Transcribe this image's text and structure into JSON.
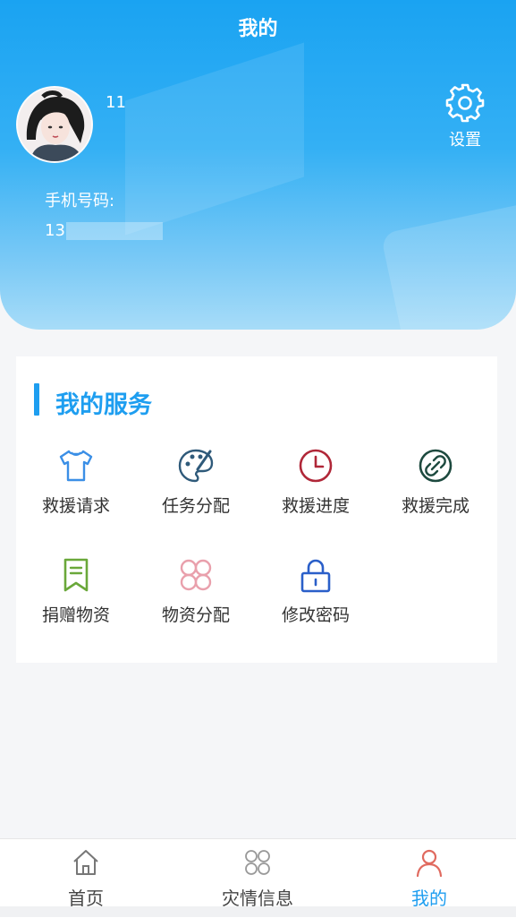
{
  "header": {
    "title": "我的",
    "username": "11",
    "settings_label": "设置",
    "phone_label": "手机号码:",
    "phone_value": "13"
  },
  "services": {
    "title": "我的服务",
    "items": [
      {
        "label": "救援请求",
        "icon": "tshirt-icon",
        "color": "#3b8fe6"
      },
      {
        "label": "任务分配",
        "icon": "palette-icon",
        "color": "#2f5a7a"
      },
      {
        "label": "救援进度",
        "icon": "clock-icon",
        "color": "#b02738"
      },
      {
        "label": "救援完成",
        "icon": "link-icon",
        "color": "#1d4a3f"
      },
      {
        "label": "捐赠物资",
        "icon": "bookmark-icon",
        "color": "#6aa83a"
      },
      {
        "label": "物资分配",
        "icon": "grid-icon",
        "color": "#e9a0ac"
      },
      {
        "label": "修改密码",
        "icon": "lock-icon",
        "color": "#2a5fc9"
      }
    ]
  },
  "tabbar": {
    "tabs": [
      {
        "label": "首页",
        "icon": "home-icon"
      },
      {
        "label": "灾情信息",
        "icon": "grid-icon"
      },
      {
        "label": "我的",
        "icon": "user-icon",
        "active": true
      }
    ]
  },
  "colors": {
    "accent": "#1e9ef0",
    "header_gradient_top": "#1aa3f2",
    "header_gradient_bottom": "#a7dcf8",
    "active_tab_icon": "#e06a5f"
  }
}
